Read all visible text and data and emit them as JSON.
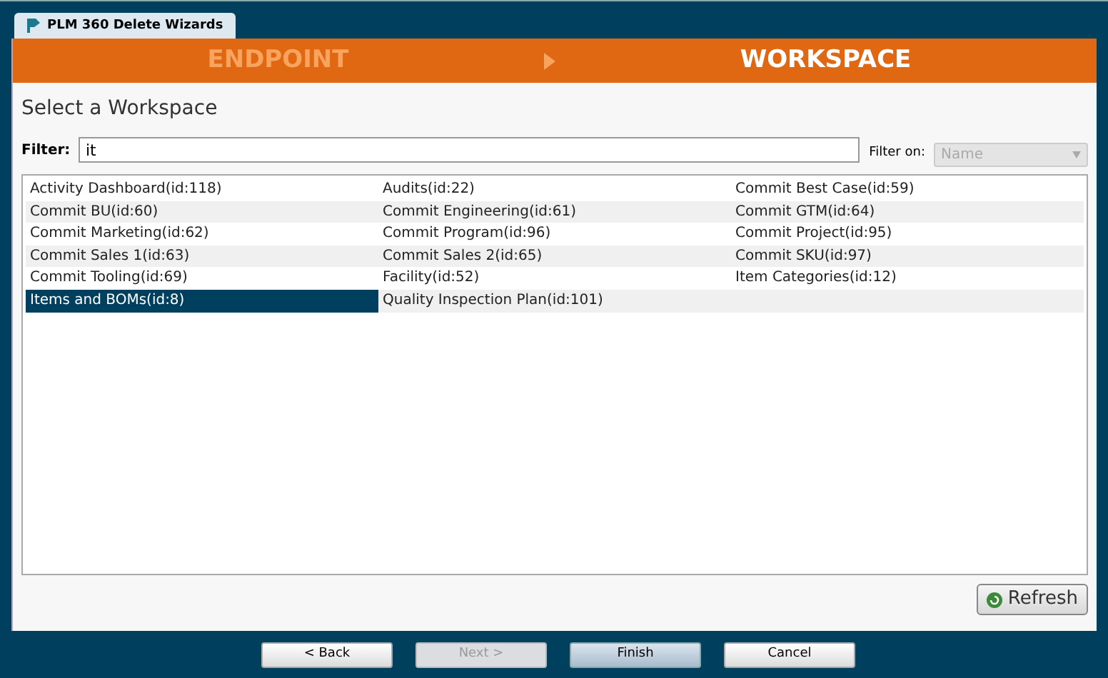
{
  "window": {
    "tab_title": "PLM 360 Delete Wizards"
  },
  "steps": [
    {
      "label": "ENDPOINT",
      "selected": false
    },
    {
      "label": "WORKSPACE",
      "selected": true
    }
  ],
  "heading": "Select a Workspace",
  "filter": {
    "label": "Filter:",
    "value": "it"
  },
  "filter_on": {
    "label": "Filter on:",
    "value": "Name",
    "disabled": true
  },
  "workspaces": [
    {
      "label": "Activity Dashboard(id:118)",
      "selected": false
    },
    {
      "label": "Audits(id:22)",
      "selected": false
    },
    {
      "label": "Commit Best Case(id:59)",
      "selected": false
    },
    {
      "label": "Commit BU(id:60)",
      "selected": false
    },
    {
      "label": "Commit Engineering(id:61)",
      "selected": false
    },
    {
      "label": "Commit GTM(id:64)",
      "selected": false
    },
    {
      "label": "Commit Marketing(id:62)",
      "selected": false
    },
    {
      "label": "Commit Program(id:96)",
      "selected": false
    },
    {
      "label": "Commit Project(id:95)",
      "selected": false
    },
    {
      "label": "Commit Sales 1(id:63)",
      "selected": false
    },
    {
      "label": "Commit Sales 2(id:65)",
      "selected": false
    },
    {
      "label": "Commit SKU(id:97)",
      "selected": false
    },
    {
      "label": "Commit Tooling(id:69)",
      "selected": false
    },
    {
      "label": "Facility(id:52)",
      "selected": false
    },
    {
      "label": "Item Categories(id:12)",
      "selected": false
    },
    {
      "label": "Items and BOMs(id:8)",
      "selected": true
    },
    {
      "label": "Quality Inspection Plan(id:101)",
      "selected": false
    }
  ],
  "refresh_button": "Refresh",
  "buttons": [
    {
      "label": "< Back",
      "disabled": false,
      "default": false
    },
    {
      "label": "Next >",
      "disabled": true,
      "default": false
    },
    {
      "label": "Finish",
      "disabled": false,
      "default": true
    },
    {
      "label": "Cancel",
      "disabled": false,
      "default": false
    }
  ]
}
